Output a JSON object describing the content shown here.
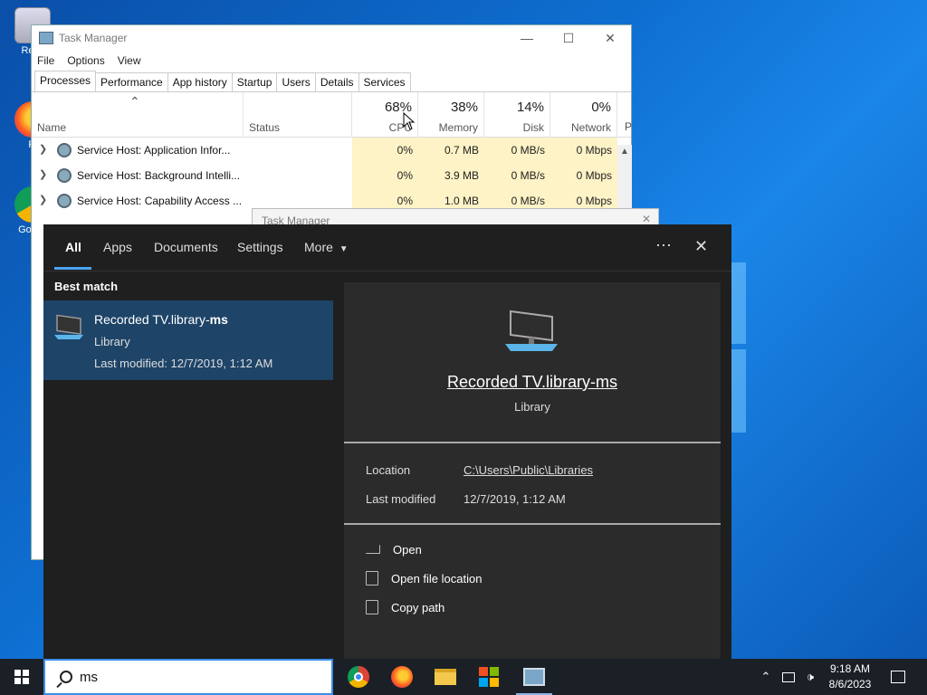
{
  "desktop": {
    "icons": [
      {
        "label": "Recy",
        "icon": "recycle-bin-icon"
      },
      {
        "label": "Fi",
        "icon": "firefox-icon"
      },
      {
        "label": "Go Ch",
        "icon": "chrome-icon"
      }
    ]
  },
  "task_manager": {
    "title": "Task Manager",
    "menu": [
      "File",
      "Options",
      "View"
    ],
    "tabs": [
      "Processes",
      "Performance",
      "App history",
      "Startup",
      "Users",
      "Details",
      "Services"
    ],
    "active_tab": "Processes",
    "columns": {
      "name": "Name",
      "status": "Status",
      "cpu": {
        "pct": "68%",
        "label": "CPU"
      },
      "memory": {
        "pct": "38%",
        "label": "Memory"
      },
      "disk": {
        "pct": "14%",
        "label": "Disk"
      },
      "network": {
        "pct": "0%",
        "label": "Network"
      },
      "power_partial": "P"
    },
    "rows": [
      {
        "name": "Service Host: Application Infor...",
        "cpu": "0%",
        "memory": "0.7 MB",
        "disk": "0 MB/s",
        "network": "0 Mbps"
      },
      {
        "name": "Service Host: Background Intelli...",
        "cpu": "0%",
        "memory": "3.9 MB",
        "disk": "0 MB/s",
        "network": "0 Mbps"
      },
      {
        "name": "Service Host: Capability Access ...",
        "cpu": "0%",
        "memory": "1.0 MB",
        "disk": "0 MB/s",
        "network": "0 Mbps"
      }
    ],
    "second_window_title": "Task Manager"
  },
  "search_panel": {
    "tabs": [
      "All",
      "Apps",
      "Documents",
      "Settings",
      "More"
    ],
    "active_tab": "All",
    "section_label": "Best match",
    "best_match": {
      "name_prefix": "Recorded TV.library-",
      "name_match": "ms",
      "type": "Library",
      "modified": "Last modified: 12/7/2019, 1:12 AM"
    },
    "detail": {
      "title": "Recorded TV.library-ms",
      "type": "Library",
      "location_label": "Location",
      "location_value": "C:\\Users\\Public\\Libraries",
      "modified_label": "Last modified",
      "modified_value": "12/7/2019, 1:12 AM",
      "actions": [
        "Open",
        "Open file location",
        "Copy path"
      ]
    }
  },
  "taskbar": {
    "search_value": "ms",
    "apps": [
      "chrome-icon",
      "firefox-icon",
      "file-explorer-icon",
      "store-icon",
      "task-manager-icon"
    ],
    "time": "9:18 AM",
    "date": "8/6/2023"
  }
}
